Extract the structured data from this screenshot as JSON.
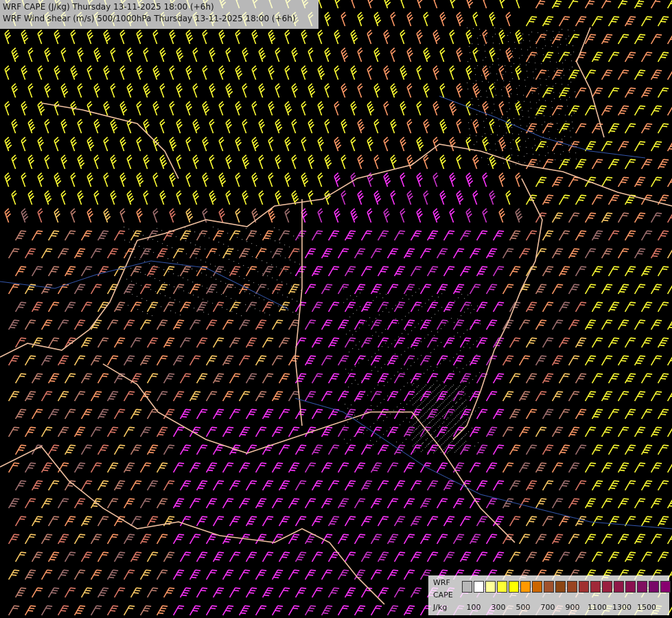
{
  "title": {
    "line1": "WRF CAPE (J/kg) Thursday 13-11-2025 18:00 (+6h)",
    "line2": "WRF Wind shear (m/s) 500/1000hPa Thursday 13-11-2025 18:00 (+6h)"
  },
  "legend": {
    "model": "WRF",
    "variable": "CAPE",
    "unit": "J/kg",
    "colors": [
      "#b8b8b8",
      "#ffffff",
      "#ffff99",
      "#ffff33",
      "#ffff00",
      "#ff9900",
      "#cc6600",
      "#a0522d",
      "#8b4513",
      "#994422",
      "#a03030",
      "#a02838",
      "#9a2040",
      "#901848",
      "#8a1050",
      "#801060",
      "#780868",
      "#880070"
    ],
    "ticks": [
      "100",
      "300",
      "500",
      "700",
      "900",
      "1100",
      "1300",
      "1500"
    ]
  },
  "map": {
    "barb_colors": [
      "#ffff33",
      "#ff9966",
      "#ff33ff",
      "#cc33cc",
      "#dd7766",
      "#c08070",
      "#a07070",
      "#ffcc66"
    ],
    "border_color": "#f0c0a0",
    "river_color": "#3355aa"
  }
}
